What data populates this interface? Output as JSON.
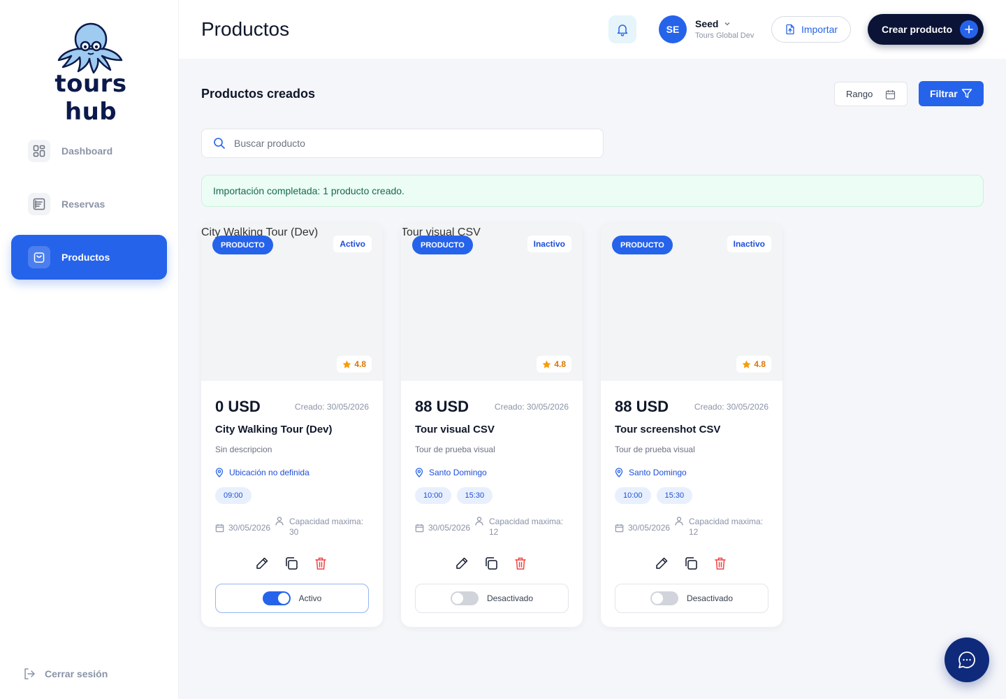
{
  "app": {
    "logo_text": "tours hub"
  },
  "sidebar": {
    "items": [
      {
        "label": "Dashboard",
        "icon": "dashboard-grid-icon",
        "active": false
      },
      {
        "label": "Reservas",
        "icon": "list-icon",
        "active": false
      },
      {
        "label": "Productos",
        "icon": "shopping-bag-icon",
        "active": true
      }
    ],
    "logout_label": "Cerrar sesión"
  },
  "header": {
    "title": "Productos",
    "user": {
      "initials": "SE",
      "name": "Seed",
      "org": "Tours Global Dev"
    },
    "import_label": "Importar",
    "create_label": "Crear producto"
  },
  "content": {
    "section_title": "Productos creados",
    "range_label": "Rango",
    "filter_label": "Filtrar",
    "search_placeholder": "Buscar producto",
    "alert": "Importación completada: 1 producto creado."
  },
  "colors": {
    "primary": "#2563eb",
    "dark": "#0b1437",
    "success_bg": "#ecfdf5",
    "rating": "#d97706"
  },
  "cards": [
    {
      "image_alt": "City Walking Tour (Dev)",
      "badge": "PRODUCTO",
      "status": "Activo",
      "rating": "4.8",
      "price": "0 USD",
      "created": "Creado: 30/05/2026",
      "name": "City Walking Tour (Dev)",
      "description": "Sin descripcion",
      "location": "Ubicación no definida",
      "times": [
        "09:00"
      ],
      "date": "30/05/2026",
      "capacity": "Capacidad maxima: 30",
      "toggle_label": "Activo",
      "enabled": true
    },
    {
      "image_alt": "Tour visual CSV",
      "badge": "PRODUCTO",
      "status": "Inactivo",
      "rating": "4.8",
      "price": "88 USD",
      "created": "Creado: 30/05/2026",
      "name": "Tour visual CSV",
      "description": "Tour de prueba visual",
      "location": "Santo Domingo",
      "times": [
        "10:00",
        "15:30"
      ],
      "date": "30/05/2026",
      "capacity": "Capacidad maxima: 12",
      "toggle_label": "Desactivado",
      "enabled": false
    },
    {
      "image_alt": "",
      "badge": "PRODUCTO",
      "status": "Inactivo",
      "rating": "4.8",
      "price": "88 USD",
      "created": "Creado: 30/05/2026",
      "name": "Tour screenshot CSV",
      "description": "Tour de prueba visual",
      "location": "Santo Domingo",
      "times": [
        "10:00",
        "15:30"
      ],
      "date": "30/05/2026",
      "capacity": "Capacidad maxima: 12",
      "toggle_label": "Desactivado",
      "enabled": false
    }
  ]
}
